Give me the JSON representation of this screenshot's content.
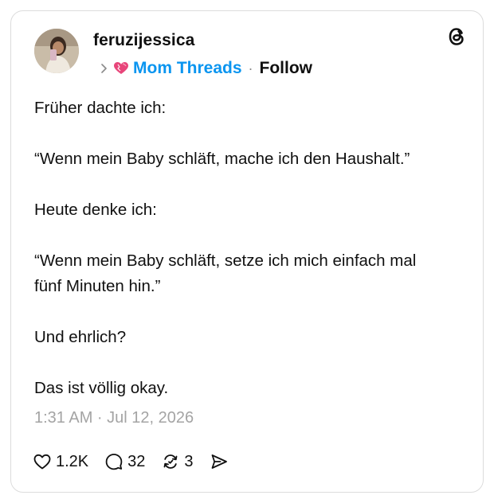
{
  "post": {
    "username": "feruzijessica",
    "community": "Mom Threads",
    "separator": "·",
    "follow_label": "Follow",
    "paragraphs": [
      "Früher dachte ich:",
      "“Wenn mein Baby schläft, mache ich den Haushalt.”",
      "Heute denke ich:",
      "“Wenn mein Baby schläft, setze ich mich einfach mal fünf Minuten hin.”",
      "Und ehrlich?",
      "Das ist völlig okay."
    ],
    "timestamp": "1:31 AM · Jul 12, 2026"
  },
  "actions": {
    "likes": "1.2K",
    "replies": "32",
    "reposts": "3"
  },
  "icons": {
    "avatar": "avatar-photo",
    "chevron": "chevron-right-icon",
    "community_emoji": "heart-emoji-icon",
    "logo": "threads-logo-icon",
    "like": "heart-icon",
    "reply": "comment-icon",
    "repost": "repost-icon",
    "share": "send-icon"
  },
  "colors": {
    "community": "#0a95f0",
    "text": "#101010",
    "muted": "#a4a4a4",
    "heart_emoji": "#e8457a"
  }
}
